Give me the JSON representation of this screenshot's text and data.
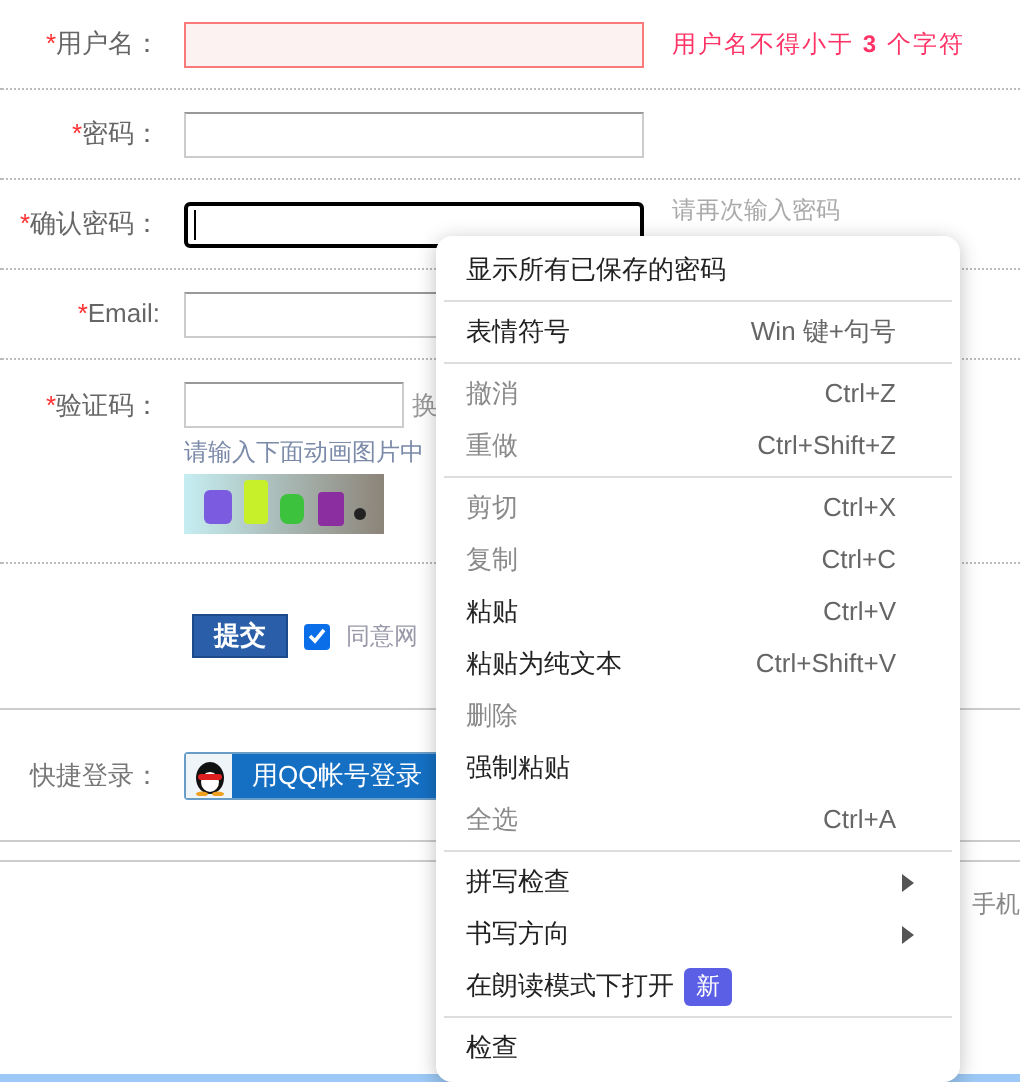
{
  "form": {
    "rows": [
      {
        "mark": "*",
        "label": "用户名：",
        "kind": "text",
        "error": true,
        "focused": false,
        "note": "用户名不得小于 **3** 个字符"
      },
      {
        "mark": "*",
        "label": "密码：",
        "kind": "text",
        "error": false,
        "focused": false
      },
      {
        "mark": "*",
        "label": "确认密码：",
        "kind": "text",
        "error": false,
        "focused": true,
        "note": "请再次输入密码"
      },
      {
        "mark": "*",
        "label": "Email:",
        "kind": "text",
        "error": false,
        "focused": false
      },
      {
        "mark": "*",
        "label": "验证码：",
        "kind": "captcha",
        "error": false,
        "focused": false,
        "link": "换",
        "hint": "请输入下面动画图片中"
      }
    ]
  },
  "submit": {
    "button": "提交",
    "agree_checked": true,
    "agree_text": "同意网"
  },
  "quick_login": {
    "label": "快捷登录：",
    "button": "用QQ帐号登录"
  },
  "footer": {
    "text": "手机"
  },
  "context_menu": {
    "items": [
      {
        "kind": "item",
        "label": "显示所有已保存的密码",
        "disabled": false,
        "separator_after": true
      },
      {
        "kind": "item",
        "label": "表情符号",
        "shortcut": "Win 键+句号",
        "disabled": false,
        "separator_after": true
      },
      {
        "kind": "item",
        "label": "撤消",
        "shortcut": "Ctrl+Z",
        "disabled": true,
        "separator_after": false
      },
      {
        "kind": "item",
        "label": "重做",
        "shortcut": "Ctrl+Shift+Z",
        "disabled": true,
        "separator_after": true
      },
      {
        "kind": "item",
        "label": "剪切",
        "shortcut": "Ctrl+X",
        "disabled": true,
        "separator_after": false
      },
      {
        "kind": "item",
        "label": "复制",
        "shortcut": "Ctrl+C",
        "disabled": true,
        "separator_after": false
      },
      {
        "kind": "item",
        "label": "粘贴",
        "shortcut": "Ctrl+V",
        "disabled": false,
        "separator_after": false
      },
      {
        "kind": "item",
        "label": "粘贴为纯文本",
        "shortcut": "Ctrl+Shift+V",
        "disabled": false,
        "separator_after": false
      },
      {
        "kind": "item",
        "label": "删除",
        "disabled": true,
        "separator_after": false
      },
      {
        "kind": "item",
        "label": "强制粘贴",
        "disabled": false,
        "separator_after": false
      },
      {
        "kind": "item",
        "label": "全选",
        "shortcut": "Ctrl+A",
        "disabled": true,
        "separator_after": true
      },
      {
        "kind": "submenu",
        "label": "拼写检查",
        "disabled": false,
        "separator_after": false
      },
      {
        "kind": "submenu",
        "label": "书写方向",
        "disabled": false,
        "separator_after": false
      },
      {
        "kind": "item",
        "label": "在朗读模式下打开",
        "badge": "新",
        "disabled": false,
        "separator_after": true
      },
      {
        "kind": "item",
        "label": "检查",
        "disabled": false,
        "separator_after": false
      }
    ]
  }
}
